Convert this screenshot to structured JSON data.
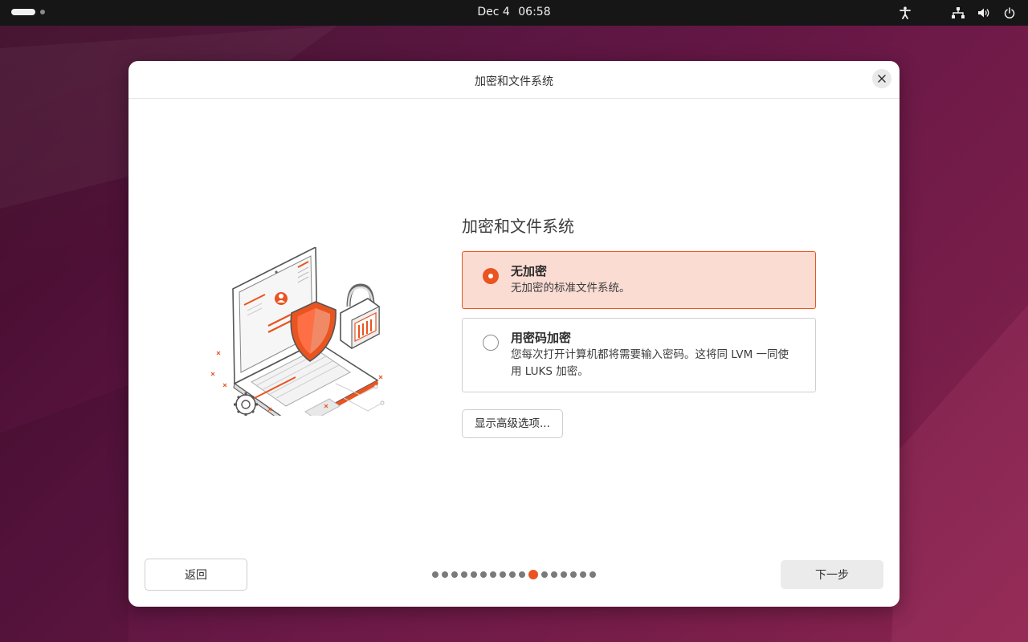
{
  "topbar": {
    "date": "Dec 4",
    "time": "06:58",
    "icons": [
      "accessibility-icon",
      "network-icon",
      "volume-icon",
      "power-icon"
    ]
  },
  "dialog": {
    "title": "加密和文件系统",
    "close_icon": "close-icon",
    "section_title": "加密和文件系统",
    "options": [
      {
        "label": "无加密",
        "description": "无加密的标准文件系统。",
        "selected": true
      },
      {
        "label": "用密码加密",
        "description": "您每次打开计算机都将需要输入密码。这将同 LVM 一同使用 LUKS 加密。",
        "selected": false
      }
    ],
    "advanced_button": "显示高级选项...",
    "back_button": "返回",
    "next_button": "下一步",
    "progress": {
      "total": 17,
      "current": 11
    }
  },
  "colors": {
    "accent": "#e95420",
    "selected_bg": "#fadcd3",
    "topbar_bg": "#161616"
  }
}
